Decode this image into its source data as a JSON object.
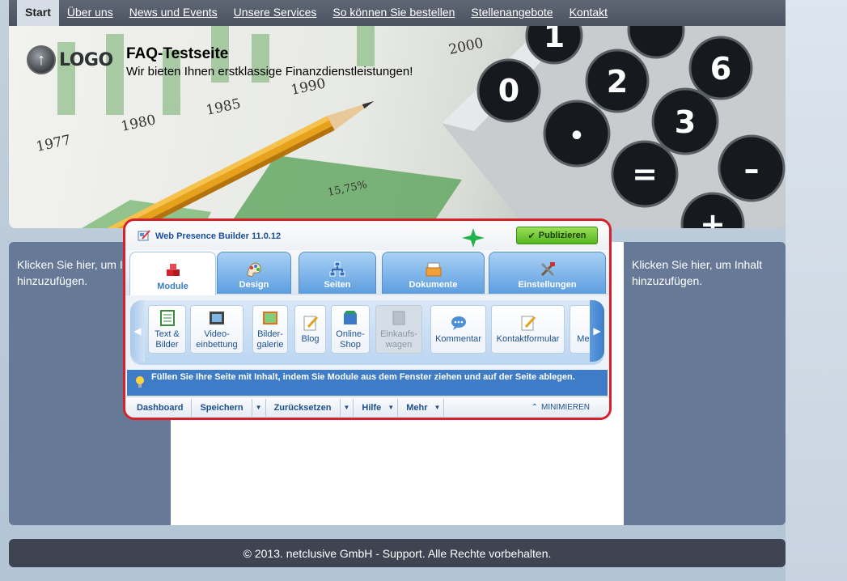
{
  "nav": {
    "items": [
      "Start",
      "Über uns",
      "News und Events",
      "Unsere Services",
      "So können Sie bestellen",
      "Stellenangebote",
      "Kontakt"
    ]
  },
  "header": {
    "logo_text": "LOGO",
    "title": "FAQ-Testseite",
    "subtitle": "Wir bieten Ihnen erstklassige Finanzdienstleistungen!"
  },
  "content": {
    "left_placeholder": "Klicken Sie hier, um Inhalt hinzuzufügen.",
    "right_placeholder": "Klicken Sie hier, um Inhalt hinzuzufügen."
  },
  "footer": {
    "text": "© 2013. netclusive GmbH - Support. Alle Rechte vorbehalten."
  },
  "editor": {
    "title": "Web Presence Builder 11.0.12",
    "publish_label": "Publizieren",
    "tabs": [
      "Module",
      "Design",
      "Seiten",
      "Dokumente",
      "Einstellungen"
    ],
    "active_tab": "Module",
    "modules": [
      "Text &\nBilder",
      "Video-\neinbettung",
      "Bilder-\ngalerie",
      "Blog",
      "Online-\nShop",
      "Einkaufs-\nwagen",
      "Kommentar",
      "Kontaktformular",
      "Med"
    ],
    "info_text": "Füllen Sie Ihre Seite mit Inhalt, indem Sie Module aus dem Fenster ziehen und auf der Seite ablegen.",
    "bottom_menu": [
      "Dashboard",
      "Speichern",
      "Zurücksetzen",
      "Hilfe",
      "Mehr"
    ],
    "minimize_label": "MINIMIEREN"
  },
  "colors": {
    "highlight_border": "#d6202a",
    "publish_green": "#55b51e",
    "accent_blue": "#3f7cc8"
  }
}
